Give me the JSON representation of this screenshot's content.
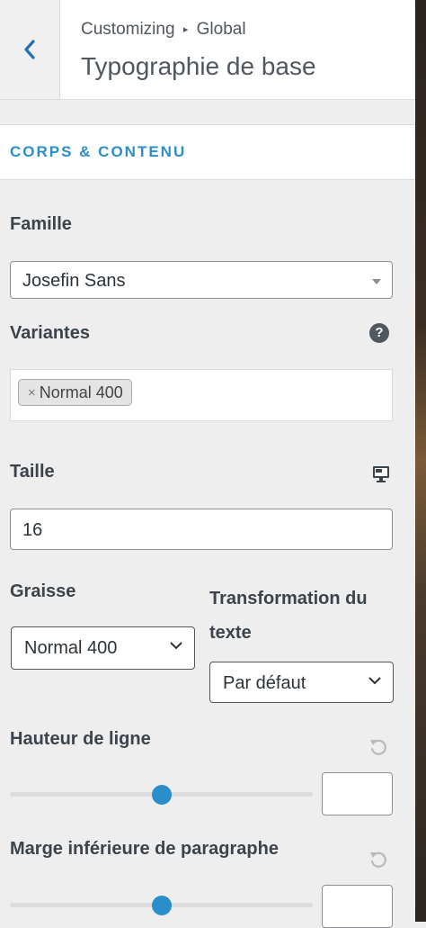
{
  "header": {
    "breadcrumb_root": "Customizing",
    "breadcrumb_separator": "▸",
    "breadcrumb_current": "Global",
    "title": "Typographie de base"
  },
  "section": {
    "title": "CORPS & CONTENU"
  },
  "famille": {
    "label": "Famille",
    "value": "Josefin Sans"
  },
  "variantes": {
    "label": "Variantes",
    "tags": [
      {
        "remove": "×",
        "label": "Normal 400"
      }
    ]
  },
  "taille": {
    "label": "Taille",
    "value": "16"
  },
  "graisse": {
    "label": "Graisse",
    "value": "Normal 400"
  },
  "transformation": {
    "label_line1": "Transformation du",
    "label_line2": "texte",
    "value": "Par défaut"
  },
  "hauteur": {
    "label": "Hauteur de ligne",
    "slider_fraction": 0.5,
    "value": ""
  },
  "marge": {
    "label": "Marge inférieure de paragraphe",
    "slider_fraction": 0.5,
    "value": ""
  },
  "colors": {
    "accent": "#2a8ecb",
    "text": "#3c434a",
    "panel": "#eeeeee"
  },
  "icons": {
    "back": "chevron-left-icon",
    "help": "question-circle-icon",
    "device": "desktop-icon",
    "reset": "reset-icon"
  }
}
